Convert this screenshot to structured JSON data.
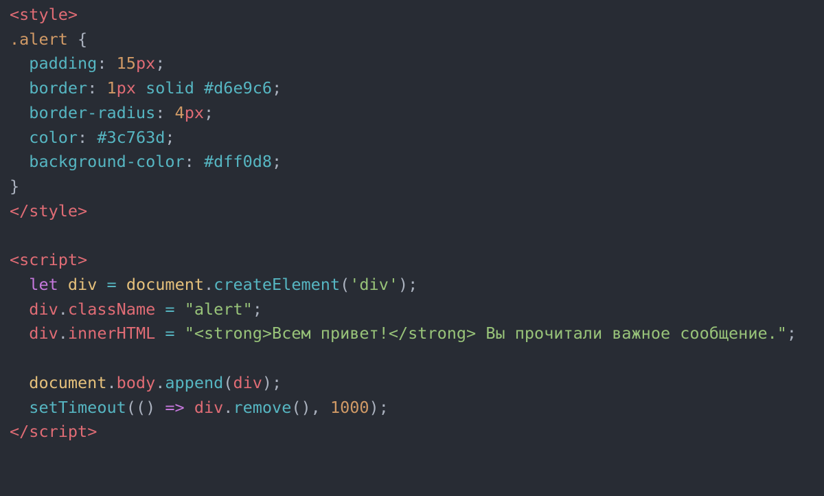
{
  "code": {
    "lines": [
      [
        {
          "t": "<",
          "c": "tok-tag"
        },
        {
          "t": "style",
          "c": "tok-tag"
        },
        {
          "t": ">",
          "c": "tok-tag"
        }
      ],
      [
        {
          "t": ".alert",
          "c": "tok-sel"
        },
        {
          "t": " ",
          "c": "tok-default"
        },
        {
          "t": "{",
          "c": "tok-brace"
        }
      ],
      [
        {
          "t": "  ",
          "c": "tok-default"
        },
        {
          "t": "padding",
          "c": "tok-prop"
        },
        {
          "t": ":",
          "c": "tok-punct"
        },
        {
          "t": " ",
          "c": "tok-default"
        },
        {
          "t": "15",
          "c": "tok-num"
        },
        {
          "t": "px",
          "c": "tok-unit"
        },
        {
          "t": ";",
          "c": "tok-punct"
        }
      ],
      [
        {
          "t": "  ",
          "c": "tok-default"
        },
        {
          "t": "border",
          "c": "tok-prop"
        },
        {
          "t": ":",
          "c": "tok-punct"
        },
        {
          "t": " ",
          "c": "tok-default"
        },
        {
          "t": "1",
          "c": "tok-num"
        },
        {
          "t": "px",
          "c": "tok-unit"
        },
        {
          "t": " ",
          "c": "tok-default"
        },
        {
          "t": "solid",
          "c": "tok-prop"
        },
        {
          "t": " ",
          "c": "tok-default"
        },
        {
          "t": "#d6e9c6",
          "c": "tok-hex"
        },
        {
          "t": ";",
          "c": "tok-punct"
        }
      ],
      [
        {
          "t": "  ",
          "c": "tok-default"
        },
        {
          "t": "border-radius",
          "c": "tok-prop"
        },
        {
          "t": ":",
          "c": "tok-punct"
        },
        {
          "t": " ",
          "c": "tok-default"
        },
        {
          "t": "4",
          "c": "tok-num"
        },
        {
          "t": "px",
          "c": "tok-unit"
        },
        {
          "t": ";",
          "c": "tok-punct"
        }
      ],
      [
        {
          "t": "  ",
          "c": "tok-default"
        },
        {
          "t": "color",
          "c": "tok-prop"
        },
        {
          "t": ":",
          "c": "tok-punct"
        },
        {
          "t": " ",
          "c": "tok-default"
        },
        {
          "t": "#3c763d",
          "c": "tok-hex"
        },
        {
          "t": ";",
          "c": "tok-punct"
        }
      ],
      [
        {
          "t": "  ",
          "c": "tok-default"
        },
        {
          "t": "background-color",
          "c": "tok-prop"
        },
        {
          "t": ":",
          "c": "tok-punct"
        },
        {
          "t": " ",
          "c": "tok-default"
        },
        {
          "t": "#dff0d8",
          "c": "tok-hex"
        },
        {
          "t": ";",
          "c": "tok-punct"
        }
      ],
      [
        {
          "t": "}",
          "c": "tok-brace"
        }
      ],
      [
        {
          "t": "</",
          "c": "tok-tag"
        },
        {
          "t": "style",
          "c": "tok-tag"
        },
        {
          "t": ">",
          "c": "tok-tag"
        }
      ],
      [
        {
          "t": "",
          "c": "tok-default"
        }
      ],
      [
        {
          "t": "<",
          "c": "tok-tag"
        },
        {
          "t": "script",
          "c": "tok-tag"
        },
        {
          "t": ">",
          "c": "tok-tag"
        }
      ],
      [
        {
          "t": "  ",
          "c": "tok-default"
        },
        {
          "t": "let",
          "c": "tok-kw"
        },
        {
          "t": " ",
          "c": "tok-default"
        },
        {
          "t": "div",
          "c": "tok-var"
        },
        {
          "t": " ",
          "c": "tok-default"
        },
        {
          "t": "=",
          "c": "tok-op"
        },
        {
          "t": " ",
          "c": "tok-default"
        },
        {
          "t": "document",
          "c": "tok-obj"
        },
        {
          "t": ".",
          "c": "tok-punct"
        },
        {
          "t": "createElement",
          "c": "tok-fn"
        },
        {
          "t": "(",
          "c": "tok-punct"
        },
        {
          "t": "'div'",
          "c": "tok-str"
        },
        {
          "t": ")",
          "c": "tok-punct"
        },
        {
          "t": ";",
          "c": "tok-punct"
        }
      ],
      [
        {
          "t": "  ",
          "c": "tok-default"
        },
        {
          "t": "div",
          "c": "tok-ident"
        },
        {
          "t": ".",
          "c": "tok-punct"
        },
        {
          "t": "className",
          "c": "tok-ident"
        },
        {
          "t": " ",
          "c": "tok-default"
        },
        {
          "t": "=",
          "c": "tok-op"
        },
        {
          "t": " ",
          "c": "tok-default"
        },
        {
          "t": "\"alert\"",
          "c": "tok-str"
        },
        {
          "t": ";",
          "c": "tok-punct"
        }
      ],
      [
        {
          "t": "  ",
          "c": "tok-default"
        },
        {
          "t": "div",
          "c": "tok-ident"
        },
        {
          "t": ".",
          "c": "tok-punct"
        },
        {
          "t": "innerHTML",
          "c": "tok-ident"
        },
        {
          "t": " ",
          "c": "tok-default"
        },
        {
          "t": "=",
          "c": "tok-op"
        },
        {
          "t": " ",
          "c": "tok-default"
        },
        {
          "t": "\"<strong>Всем привет!</strong> Вы прочитали важное сообщение.\"",
          "c": "tok-str"
        },
        {
          "t": ";",
          "c": "tok-punct"
        }
      ],
      [
        {
          "t": "",
          "c": "tok-default"
        }
      ],
      [
        {
          "t": "  ",
          "c": "tok-default"
        },
        {
          "t": "document",
          "c": "tok-obj"
        },
        {
          "t": ".",
          "c": "tok-punct"
        },
        {
          "t": "body",
          "c": "tok-ident"
        },
        {
          "t": ".",
          "c": "tok-punct"
        },
        {
          "t": "append",
          "c": "tok-fn"
        },
        {
          "t": "(",
          "c": "tok-punct"
        },
        {
          "t": "div",
          "c": "tok-ident"
        },
        {
          "t": ")",
          "c": "tok-punct"
        },
        {
          "t": ";",
          "c": "tok-punct"
        }
      ],
      [
        {
          "t": "  ",
          "c": "tok-default"
        },
        {
          "t": "setTimeout",
          "c": "tok-fn"
        },
        {
          "t": "(",
          "c": "tok-punct"
        },
        {
          "t": "()",
          "c": "tok-default"
        },
        {
          "t": " ",
          "c": "tok-default"
        },
        {
          "t": "=>",
          "c": "tok-kw"
        },
        {
          "t": " ",
          "c": "tok-default"
        },
        {
          "t": "div",
          "c": "tok-ident"
        },
        {
          "t": ".",
          "c": "tok-punct"
        },
        {
          "t": "remove",
          "c": "tok-fn"
        },
        {
          "t": "()",
          "c": "tok-punct"
        },
        {
          "t": ",",
          "c": "tok-punct"
        },
        {
          "t": " ",
          "c": "tok-default"
        },
        {
          "t": "1000",
          "c": "tok-num"
        },
        {
          "t": ")",
          "c": "tok-punct"
        },
        {
          "t": ";",
          "c": "tok-punct"
        }
      ],
      [
        {
          "t": "</",
          "c": "tok-tag"
        },
        {
          "t": "script",
          "c": "tok-tag"
        },
        {
          "t": ">",
          "c": "tok-tag"
        }
      ]
    ]
  }
}
